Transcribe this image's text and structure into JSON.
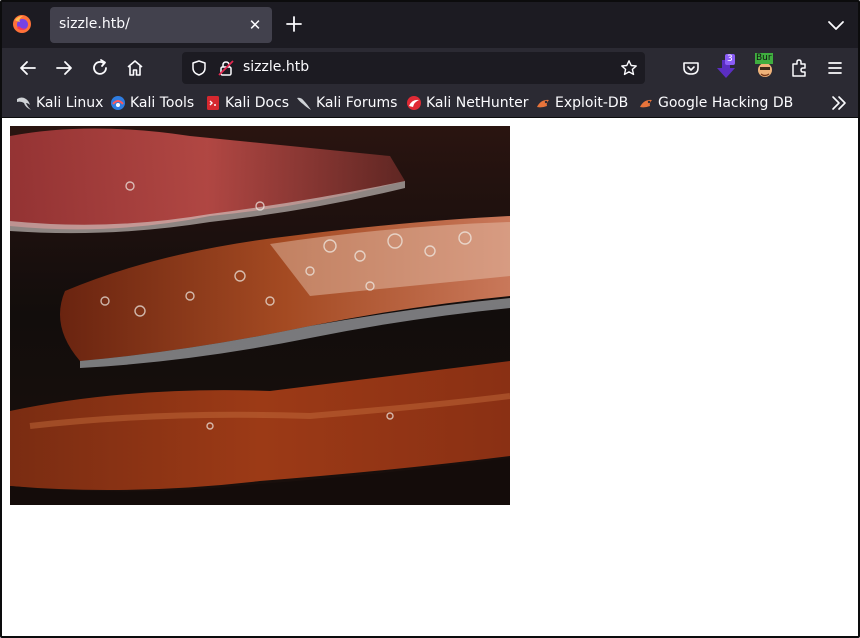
{
  "browser": {
    "tab": {
      "title": "sizzle.htb/"
    },
    "urlbar": {
      "url": "sizzle.htb"
    },
    "extensions": {
      "download_badge": "3",
      "burp_label": "Bur"
    }
  },
  "bookmarks": [
    {
      "label": "Kali Linux",
      "icon": "kali-dragon-icon"
    },
    {
      "label": "Kali Tools",
      "icon": "kali-tools-icon"
    },
    {
      "label": "Kali Docs",
      "icon": "kali-docs-icon"
    },
    {
      "label": "Kali Forums",
      "icon": "kali-dragon-icon"
    },
    {
      "label": "Kali NetHunter",
      "icon": "nethunter-icon"
    },
    {
      "label": "Exploit-DB",
      "icon": "exploitdb-icon"
    },
    {
      "label": "Google Hacking DB",
      "icon": "exploitdb-icon"
    }
  ],
  "page": {
    "image": {
      "subject": "frying bacon",
      "icon": "bacon-image"
    }
  },
  "colors": {
    "tabstrip_bg": "#1c1b22",
    "toolbar_bg": "#2b2a33",
    "active_tab_bg": "#42414d",
    "urlbar_bg": "#1c1b22",
    "text": "#fbfbfe"
  }
}
